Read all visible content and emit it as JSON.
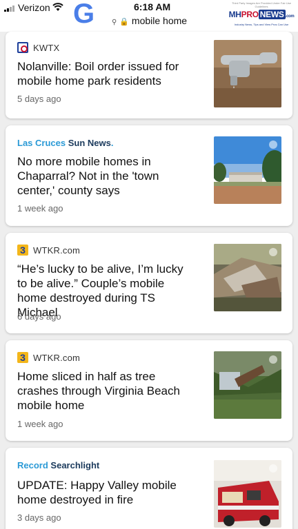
{
  "status_bar": {
    "carrier": "Verizon",
    "time": "6:18 AM",
    "url": "mobile home",
    "google_logo": "G",
    "watermark": {
      "top_note": "Third Party Images Are Provided Under Fair Use Guidelines",
      "brand_mh": "MH",
      "brand_pro": "PRO",
      "brand_news": "NEWS",
      "brand_com": ".com",
      "tagline": "Industry News, Tips and View Pros Can Use"
    }
  },
  "cards": [
    {
      "source": "KWTX",
      "headline": "Nolanville: Boil order issued for mobile home park residents",
      "time_ago": "5 days ago",
      "icon": "kwtx-logo"
    },
    {
      "source_brand_a": "Las Cruces",
      "source_brand_b": "Sun News",
      "source_brand_dot": ".",
      "headline": "No more mobile homes in Chaparral? Not in the 'town center,' county says",
      "time_ago": "1 week ago"
    },
    {
      "source": "WTKR.com",
      "logo_char": "3",
      "headline": "“He’s lucky to be alive, I’m lucky to be alive.” Couple’s mobile home destroyed during TS Michael",
      "time_ago": "6 days ago"
    },
    {
      "source": "WTKR.com",
      "logo_char": "3",
      "headline": "Home sliced in half as tree crashes through Virginia Beach mobile home",
      "time_ago": "1 week ago"
    },
    {
      "source_brand_a": "Record",
      "source_brand_b": "Searchlight",
      "headline": "UPDATE: Happy Valley mobile home destroyed in fire",
      "time_ago": "3 days ago"
    }
  ],
  "colors": {
    "google_blue": "#4a7ee8",
    "brand_blue": "#2b9ad6",
    "brand_navy": "#1b3a5c"
  }
}
